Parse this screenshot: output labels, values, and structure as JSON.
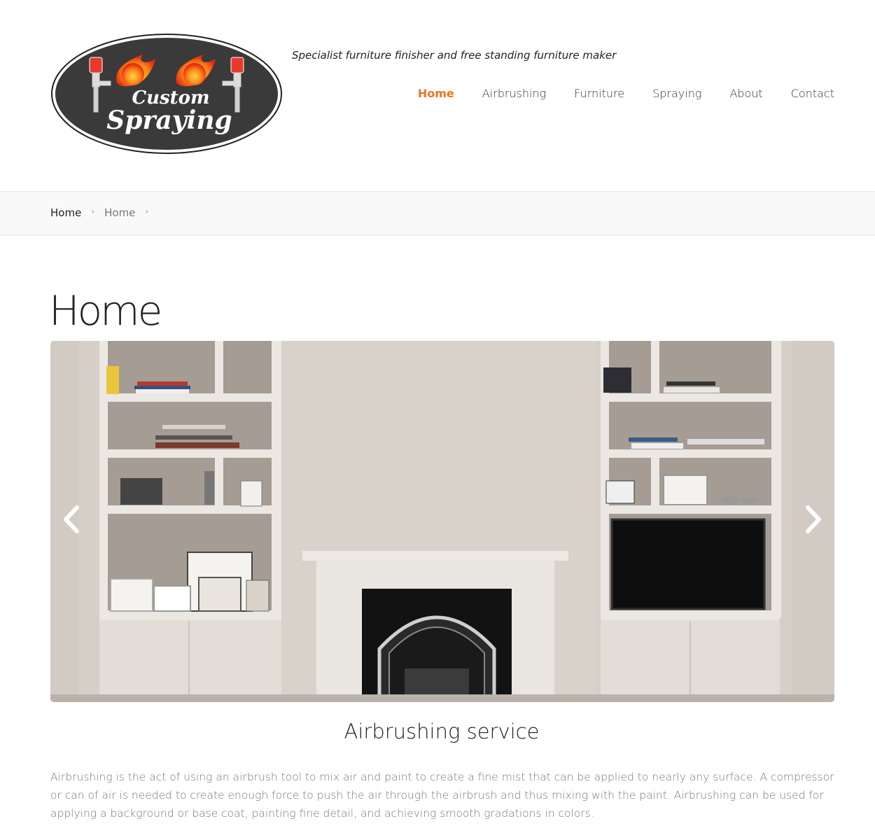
{
  "header": {
    "logo": {
      "line1": "Custom",
      "line2": "Spraying"
    },
    "tagline": "Specialist furniture finisher and free standing furniture maker"
  },
  "nav": {
    "items": [
      {
        "label": "Home",
        "active": true
      },
      {
        "label": "Airbrushing",
        "active": false
      },
      {
        "label": "Furniture",
        "active": false
      },
      {
        "label": "Spraying",
        "active": false
      },
      {
        "label": "About",
        "active": false
      },
      {
        "label": "Contact",
        "active": false
      }
    ]
  },
  "breadcrumb": {
    "items": [
      "Home",
      "Home"
    ],
    "separator": "›"
  },
  "page": {
    "title": "Home"
  },
  "slider": {
    "prev_icon": "chevron-left-icon",
    "next_icon": "chevron-right-icon"
  },
  "section": {
    "heading": "Airbrushing service",
    "body": "Airbrushing is the act of using an airbrush tool to mix air and paint to create a fine mist that can be applied to nearly any surface. A compressor or can of air is needed to create enough force to push the air through the airbrush and thus mixing with the paint. Airbrushing can be used for applying a background or base coat, painting fine detail, and achieving smooth gradations in colors."
  },
  "colors": {
    "accent": "#f07420",
    "logo_bg": "#3a3a3a",
    "breadcrumb_bg": "#f9f9f9",
    "body_text": "#777777"
  }
}
